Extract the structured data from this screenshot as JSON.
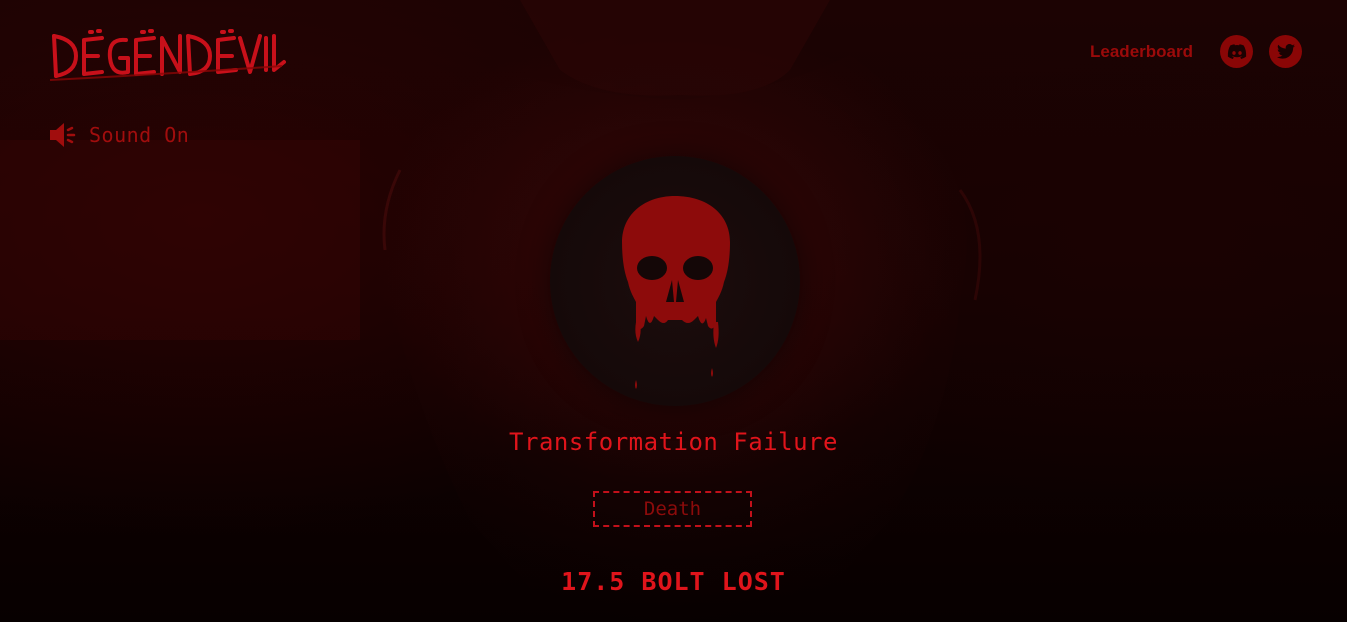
{
  "brand": {
    "logo_text": "DËGËNDËVIL"
  },
  "sound": {
    "label": "Sound On"
  },
  "nav": {
    "leaderboard_label": "Leaderboard",
    "social": [
      {
        "icon": "discord-icon"
      },
      {
        "icon": "twitter-icon"
      }
    ]
  },
  "result": {
    "title": "Transformation Failure",
    "status": "Death",
    "loss": "17.5 BOLT LOST"
  },
  "colors": {
    "accent": "#e0141b",
    "dark_red": "#8a0606",
    "background": "#150202"
  }
}
